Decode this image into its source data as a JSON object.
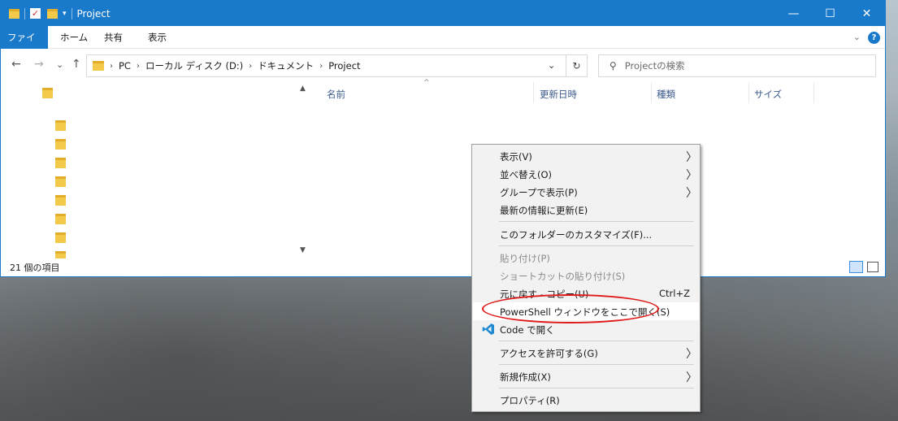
{
  "window": {
    "title": "Project",
    "controls": {
      "minimize": "—",
      "maximize": "☐",
      "close": "✕"
    }
  },
  "quick_access": {
    "check_mark": "✓",
    "dropdown": "▾"
  },
  "ribbon": {
    "tabs": [
      "ファイル",
      "ホーム",
      "共有",
      "表示"
    ],
    "collapse_glyph": "⌄",
    "help_glyph": "?"
  },
  "navigation": {
    "back": "←",
    "forward": "→",
    "recent": "⌄",
    "up": "↑",
    "breadcrumb": [
      "PC",
      "ローカル ディスク (D:)",
      "ドキュメント",
      "Project"
    ],
    "breadcrumb_sep": "›",
    "address_dropdown": "⌄",
    "refresh": "↻",
    "search_placeholder": "Projectの検索"
  },
  "columns": {
    "name": "名前",
    "modified": "更新日時",
    "type": "種類",
    "size": "サイズ",
    "sort_glyph": "^"
  },
  "scroll": {
    "up": "▲",
    "down": "▼"
  },
  "status": {
    "item_count": "21 個の項目"
  },
  "context_menu": {
    "items": [
      {
        "label": "表示(V)",
        "submenu": "〉"
      },
      {
        "label": "並べ替え(O)",
        "submenu": "〉"
      },
      {
        "label": "グループで表示(P)",
        "submenu": "〉"
      },
      {
        "label": "最新の情報に更新(E)"
      },
      {
        "label": "このフォルダーのカスタマイズ(F)..."
      },
      {
        "label": "貼り付け(P)",
        "disabled": true
      },
      {
        "label": "ショートカットの貼り付け(S)",
        "disabled": true
      },
      {
        "label": "元に戻す - コピー(U)",
        "shortcut": "Ctrl+Z"
      },
      {
        "label": "PowerShell ウィンドウをここで開く(S)"
      },
      {
        "label": "Code で開く",
        "icon": "vscode-icon"
      },
      {
        "label": "アクセスを許可する(G)",
        "submenu": "〉"
      },
      {
        "label": "新規作成(X)",
        "submenu": "〉"
      },
      {
        "label": "プロパティ(R)"
      }
    ]
  },
  "colors": {
    "accent": "#1979ca",
    "folder": "#f3c94a",
    "annotation_ring": "#e01a1a",
    "vscode_blue": "#1f8ad2"
  }
}
